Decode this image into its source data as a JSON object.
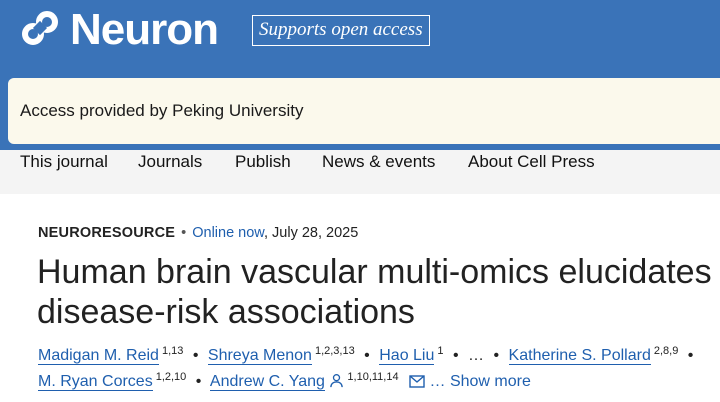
{
  "header": {
    "logo_text": "Neuron",
    "open_access_badge": "Supports open access",
    "brand_color": "#3a73b8"
  },
  "access_notice": "Access provided by Peking University",
  "nav": {
    "items": [
      "This journal",
      "Journals",
      "Publish",
      "News & events",
      "About Cell Press"
    ]
  },
  "article": {
    "type": "NEURORESOURCE",
    "bullet": "•",
    "online_label": "Online now",
    "date": ", July 28, 2025",
    "title": "Human brain vascular multi-omics elucidates disease-risk associations",
    "authors": [
      {
        "name": "Madigan M. Reid",
        "affil": "1,13"
      },
      {
        "name": "Shreya Menon",
        "affil": "1,2,3,13"
      },
      {
        "name": "Hao Liu",
        "affil": "1"
      },
      {
        "name": "Katherine S. Pollard",
        "affil": "2,8,9"
      },
      {
        "name": "M. Ryan Corces",
        "affil": "1,2,10"
      },
      {
        "name": "Andrew C. Yang",
        "affil": "1,10,11,14"
      }
    ],
    "ellipsis": "…",
    "show_more": "… Show more",
    "link_color": "#1f5fae"
  }
}
